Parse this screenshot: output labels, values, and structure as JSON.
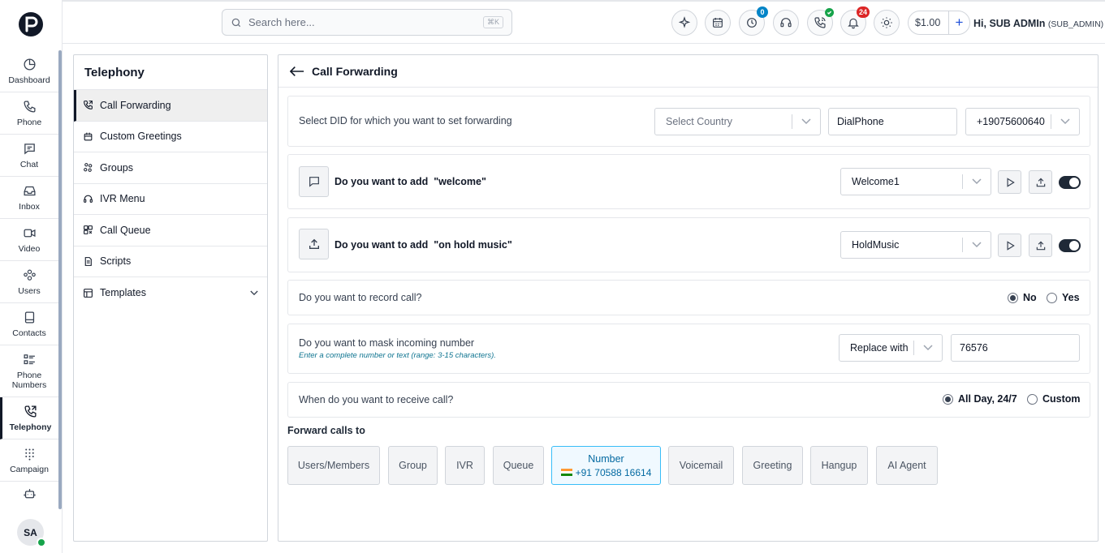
{
  "rail": {
    "items": [
      {
        "label": "Dashboard"
      },
      {
        "label": "Phone"
      },
      {
        "label": "Chat"
      },
      {
        "label": "Inbox"
      },
      {
        "label": "Video"
      },
      {
        "label": "Users"
      },
      {
        "label": "Contacts"
      },
      {
        "label": "Phone Numbers"
      },
      {
        "label": "Telephony"
      },
      {
        "label": "Campaign"
      }
    ],
    "avatar_initials": "SA"
  },
  "header": {
    "search_placeholder": "Search here...",
    "search_shortcut": "⌘K",
    "badges": {
      "history": "0",
      "notifications": "24"
    },
    "balance": "$1.00",
    "balance_add": "+",
    "greeting": "Hi, SUB ADMIn",
    "role": "(SUB_ADMIN)"
  },
  "submenu": {
    "title": "Telephony",
    "items": [
      {
        "label": "Call Forwarding"
      },
      {
        "label": "Custom Greetings"
      },
      {
        "label": "Groups"
      },
      {
        "label": "IVR Menu"
      },
      {
        "label": "Call Queue"
      },
      {
        "label": "Scripts"
      },
      {
        "label": "Templates"
      }
    ]
  },
  "main": {
    "title": "Call Forwarding",
    "did": {
      "label": "Select DID for which you want to set forwarding",
      "country_placeholder": "Select Country",
      "provider": "DialPhone",
      "number": "+19075600640"
    },
    "welcome": {
      "question": "Do you want to add  \"welcome\"",
      "selected": "Welcome1",
      "enabled": true
    },
    "hold_music": {
      "question": "Do you want to add  \"on hold music\"",
      "selected": "HoldMusic",
      "enabled": true
    },
    "record": {
      "question": "Do you want to record call?",
      "options": [
        "No",
        "Yes"
      ],
      "selected": "No"
    },
    "mask": {
      "question": "Do you want to mask incoming number",
      "hint": "Enter a complete number or text (range: 3-15 characters).",
      "mode": "Replace with",
      "value": "76576"
    },
    "receive": {
      "question": "When do you want to receive call?",
      "options": [
        "All Day, 24/7",
        "Custom"
      ],
      "selected": "All Day, 24/7"
    },
    "forward": {
      "title": "Forward calls to",
      "options": [
        "Users/Members",
        "Group",
        "IVR",
        "Queue",
        "Number",
        "Voicemail",
        "Greeting",
        "Hangup",
        "AI Agent"
      ],
      "selected": "Number",
      "selected_number": "+91 70588 16614"
    }
  },
  "colors": {
    "accent": "#1f2937",
    "link": "#0e7490",
    "selected_border": "#38bdf8",
    "notification_badge": "#dc2626",
    "history_badge": "#0284c7",
    "online": "#16a34a"
  }
}
